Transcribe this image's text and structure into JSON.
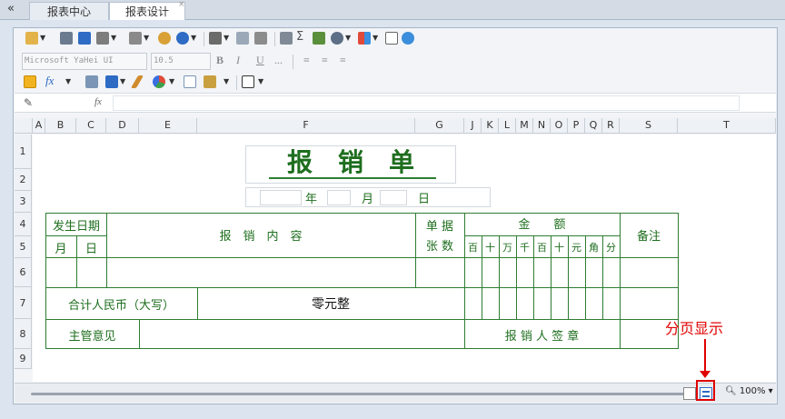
{
  "tabs": {
    "collapse": "«",
    "items": [
      {
        "label": "报表中心"
      },
      {
        "label": "报表设计"
      }
    ],
    "close": "×"
  },
  "toolbar": {
    "font_name": "Microsoft YaHei UI",
    "font_size": "10.5",
    "bold": "B",
    "italic": "I",
    "underline": "U",
    "more": "...",
    "sigma": "Σ",
    "fx": "fx"
  },
  "columns": [
    "A",
    "B",
    "C",
    "D",
    "E",
    "F",
    "G",
    "J",
    "K",
    "L",
    "M",
    "N",
    "O",
    "P",
    "Q",
    "R",
    "S",
    "T"
  ],
  "rows": [
    "1",
    "2",
    "3",
    "4",
    "5",
    "6",
    "7",
    "8",
    "9"
  ],
  "form": {
    "title": "报　销　单",
    "year": "年",
    "month": "月",
    "day": "日",
    "date_header": "发生日期",
    "month_col": "月",
    "day_col": "日",
    "content_header": "报　销　内　容",
    "doc_header_1": "单 据",
    "doc_header_2": "张 数",
    "amount_header": "金　　额",
    "amount_units": [
      "百",
      "十",
      "万",
      "千",
      "百",
      "十",
      "元",
      "角",
      "分"
    ],
    "remark_header": "备注",
    "total_label": "合计人民币（大写）",
    "total_value": "零元整",
    "supervisor_label": "主管意见",
    "signer_label": "报 销 人 签 章"
  },
  "annotation": "分页显示",
  "zoom": "100%"
}
